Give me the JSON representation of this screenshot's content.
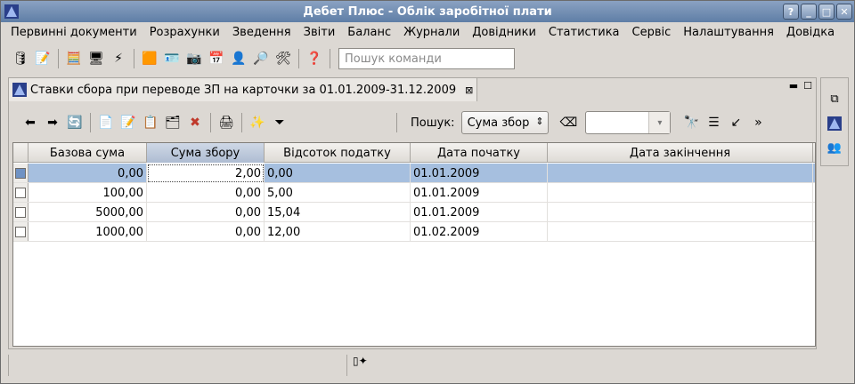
{
  "window": {
    "title": "Дебет Плюс - Облік заробітної плати"
  },
  "menu": [
    "Первинні документи",
    "Розрахунки",
    "Зведення",
    "Звіти",
    "Баланс",
    "Журнали",
    "Довідники",
    "Статистика",
    "Сервіс",
    "Налаштування",
    "Довідка"
  ],
  "toolbar": {
    "command_placeholder": "Пошук команди"
  },
  "tab": {
    "title": "Ставки сбора при переводе ЗП на карточки за 01.01.2009-31.12.2009"
  },
  "search": {
    "label": "Пошук:",
    "field": "Сума збор"
  },
  "table": {
    "columns": [
      "Базова сума",
      "Сума збору",
      "Відсоток податку",
      "Дата початку",
      "Дата закінчення"
    ],
    "rows": [
      [
        "0,00",
        "2,00",
        "0,00",
        "01.01.2009",
        ""
      ],
      [
        "100,00",
        "0,00",
        "5,00",
        "01.01.2009",
        ""
      ],
      [
        "5000,00",
        "0,00",
        "15,04",
        "01.01.2009",
        ""
      ],
      [
        "1000,00",
        "0,00",
        "12,00",
        "01.02.2009",
        ""
      ]
    ]
  },
  "colors": {
    "titlebar": "#6f8bb0",
    "selection": "#a6bfdf"
  }
}
